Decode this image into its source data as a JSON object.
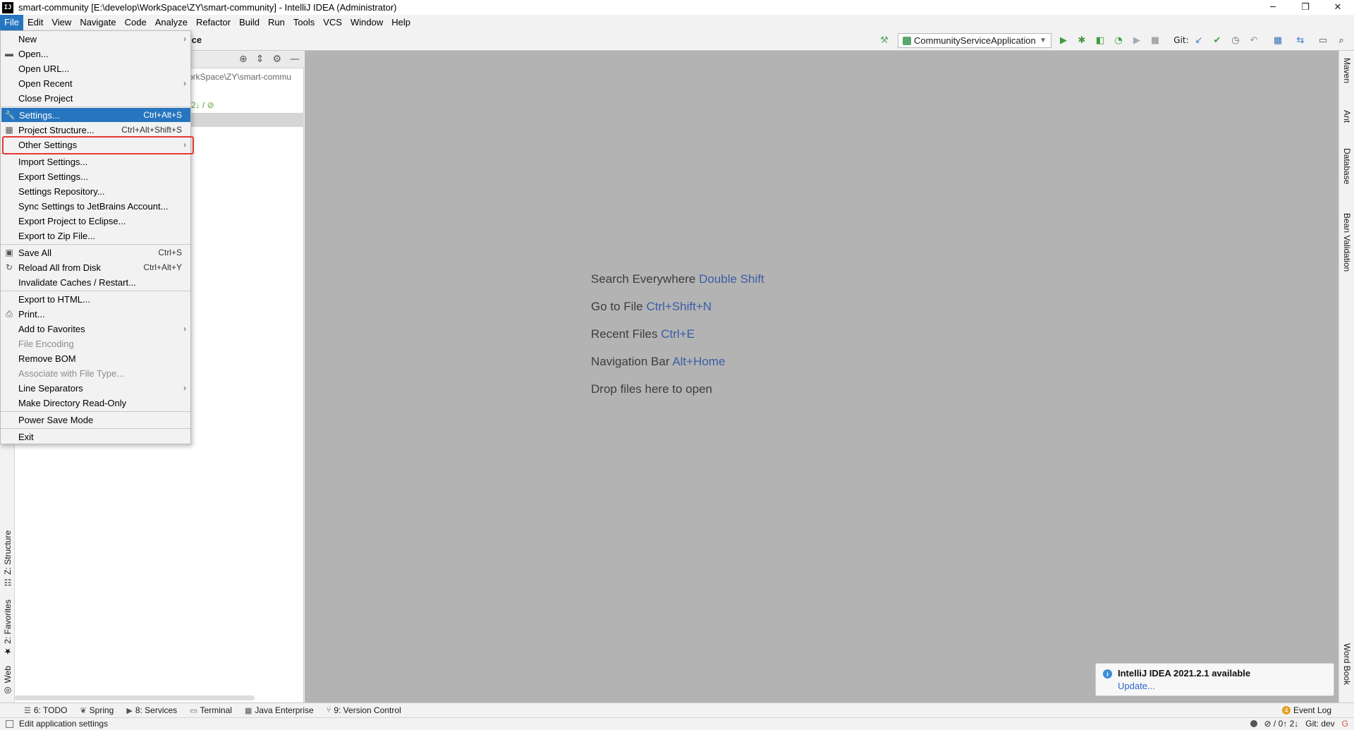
{
  "window": {
    "title": "smart-community [E:\\develop\\WorkSpace\\ZY\\smart-community] - IntelliJ IDEA (Administrator)",
    "logo": "IJ",
    "controls": [
      "─",
      "❐",
      "✕"
    ]
  },
  "menubar": {
    "items": [
      "File",
      "Edit",
      "View",
      "Navigate",
      "Code",
      "Analyze",
      "Refactor",
      "Build",
      "Run",
      "Tools",
      "VCS",
      "Window",
      "Help"
    ],
    "active": "File"
  },
  "toolbar": {
    "breadcrumb": "ice",
    "run_config": "CommunityServiceApplication",
    "git_label": "Git:"
  },
  "project_panel": {
    "path": "orkSpace\\ZY\\smart-commu",
    "git_status": "2↓ / ⊘"
  },
  "file_menu": {
    "items": [
      {
        "label": "New",
        "submenu": true
      },
      {
        "label": "Open...",
        "icon": "folder-icon"
      },
      {
        "label": "Open URL..."
      },
      {
        "label": "Open Recent",
        "submenu": true
      },
      {
        "label": "Close Project"
      },
      {
        "label": "Settings...",
        "shortcut": "Ctrl+Alt+S",
        "icon": "wrench-icon",
        "selected": true
      },
      {
        "label": "Project Structure...",
        "shortcut": "Ctrl+Alt+Shift+S",
        "icon": "project-structure-icon"
      },
      {
        "label": "Other Settings",
        "submenu": true
      },
      {
        "label": "Import Settings..."
      },
      {
        "label": "Export Settings..."
      },
      {
        "label": "Settings Repository..."
      },
      {
        "label": "Sync Settings to JetBrains Account..."
      },
      {
        "label": "Export Project to Eclipse..."
      },
      {
        "label": "Export to Zip File..."
      },
      {
        "label": "Save All",
        "shortcut": "Ctrl+S",
        "icon": "save-icon"
      },
      {
        "label": "Reload All from Disk",
        "shortcut": "Ctrl+Alt+Y",
        "icon": "reload-icon"
      },
      {
        "label": "Invalidate Caches / Restart..."
      },
      {
        "label": "Export to HTML..."
      },
      {
        "label": "Print...",
        "icon": "print-icon"
      },
      {
        "label": "Add to Favorites",
        "submenu": true
      },
      {
        "label": "File Encoding",
        "disabled": true
      },
      {
        "label": "Remove BOM"
      },
      {
        "label": "Associate with File Type...",
        "disabled": true
      },
      {
        "label": "Line Separators",
        "submenu": true
      },
      {
        "label": "Make Directory Read-Only"
      },
      {
        "label": "Power Save Mode"
      },
      {
        "label": "Exit"
      }
    ]
  },
  "editor": {
    "hints": [
      {
        "text": "Search Everywhere",
        "key": "Double Shift"
      },
      {
        "text": "Go to File",
        "key": "Ctrl+Shift+N"
      },
      {
        "text": "Recent Files",
        "key": "Ctrl+E"
      },
      {
        "text": "Navigation Bar",
        "key": "Alt+Home"
      },
      {
        "text": "Drop files here to open",
        "key": ""
      }
    ]
  },
  "notification": {
    "title": "IntelliJ IDEA 2021.2.1 available",
    "link": "Update..."
  },
  "left_stripe": {
    "tabs": [
      "Z: Structure",
      "2: Favorites",
      "Web"
    ]
  },
  "right_stripe": {
    "tabs": [
      "Maven",
      "Ant",
      "Database",
      "Bean Validation",
      "Word Book"
    ]
  },
  "bottom_tabs": {
    "items": [
      "6: TODO",
      "Spring",
      "8: Services",
      "Terminal",
      "Java Enterprise",
      "9: Version Control"
    ],
    "event_log": "Event Log"
  },
  "statusbar": {
    "message": "Edit application settings",
    "git_counts": "⊘ / 0↑ 2↓",
    "branch": "Git: dev"
  }
}
